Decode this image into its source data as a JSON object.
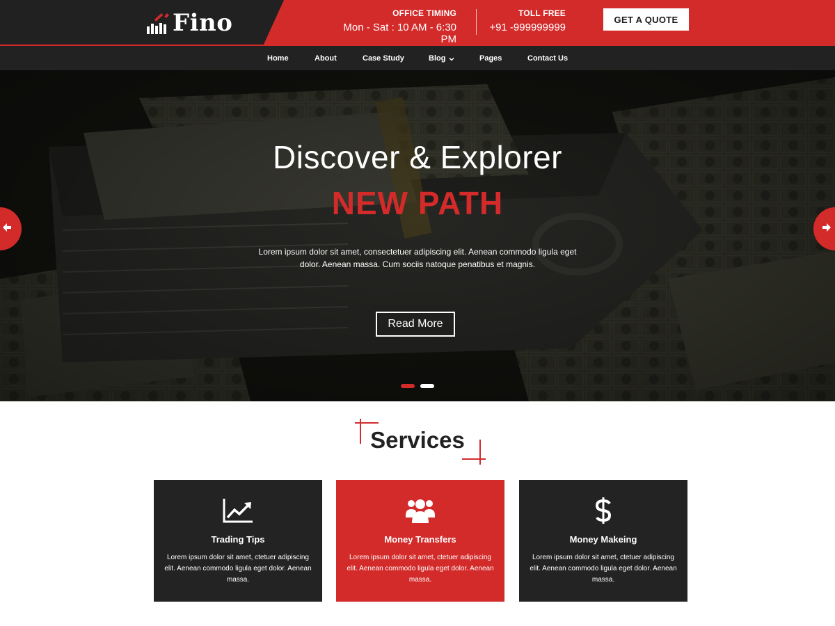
{
  "header": {
    "logo_text": "Fino",
    "office": {
      "label": "OFFICE TIMING",
      "value": "Mon - Sat : 10 AM - 6:30 PM"
    },
    "toll_free": {
      "label": "TOLL FREE",
      "value": "+91 -999999999"
    },
    "quote_button": "GET A QUOTE"
  },
  "nav": {
    "items": [
      {
        "label": "Home"
      },
      {
        "label": "About"
      },
      {
        "label": "Case Study"
      },
      {
        "label": "Blog",
        "has_dropdown": true
      },
      {
        "label": "Pages"
      },
      {
        "label": "Contact Us"
      }
    ]
  },
  "hero": {
    "title": "Discover & Explorer",
    "subtitle": "NEW PATH",
    "text": "Lorem ipsum dolor sit amet, consectetuer adipiscing elit. Aenean commodo ligula eget dolor. Aenean massa. Cum sociis natoque penatibus et magnis.",
    "button": "Read More",
    "slides_total": 2,
    "active_slide": 1
  },
  "services": {
    "heading": "Services",
    "cards": [
      {
        "icon": "trending-chart-icon",
        "title": "Trading Tips",
        "text": "Lorem ipsum dolor sit amet, ctetuer adipiscing elit. Aenean commodo ligula eget dolor. Aenean massa."
      },
      {
        "icon": "users-group-icon",
        "title": "Money Transfers",
        "text": "Lorem ipsum dolor sit amet, ctetuer adipiscing elit. Aenean commodo ligula eget dolor. Aenean massa."
      },
      {
        "icon": "dollar-icon",
        "title": "Money Makeing",
        "text": "Lorem ipsum dolor sit amet, ctetuer adipiscing elit. Aenean commodo ligula eget dolor. Aenean massa."
      }
    ]
  },
  "colors": {
    "accent": "#d32a2a",
    "dark": "#222222"
  }
}
